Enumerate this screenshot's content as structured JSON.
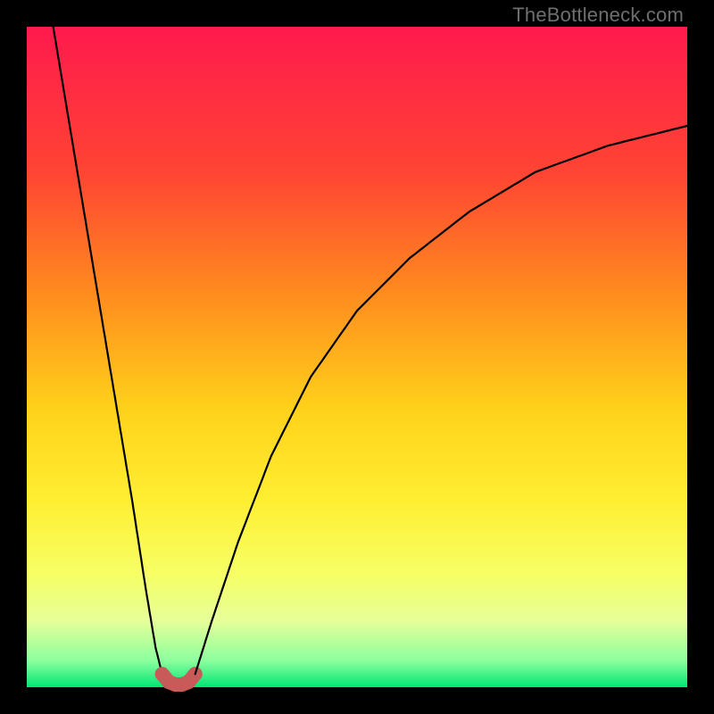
{
  "watermark": "TheBottleneck.com",
  "chart_data": {
    "type": "line",
    "title": "",
    "xlabel": "",
    "ylabel": "",
    "xlim": [
      0,
      100
    ],
    "ylim": [
      0,
      100
    ],
    "annotations": [
      "TheBottleneck.com"
    ],
    "background": {
      "type": "vertical-gradient",
      "stops": [
        {
          "pos": 0.0,
          "color": "#ff1a4d"
        },
        {
          "pos": 0.22,
          "color": "#ff4433"
        },
        {
          "pos": 0.4,
          "color": "#ff8a1f"
        },
        {
          "pos": 0.58,
          "color": "#ffd21a"
        },
        {
          "pos": 0.72,
          "color": "#ffef33"
        },
        {
          "pos": 0.83,
          "color": "#f6ff66"
        },
        {
          "pos": 0.9,
          "color": "#e6ff99"
        },
        {
          "pos": 0.96,
          "color": "#8cff9e"
        },
        {
          "pos": 1.0,
          "color": "#00e676"
        }
      ]
    },
    "series": [
      {
        "name": "left-branch",
        "stroke": "#000000",
        "x": [
          4,
          6,
          8,
          10,
          12,
          14,
          16,
          18,
          19.5,
          20.5
        ],
        "y": [
          100,
          88,
          76,
          64,
          52,
          40,
          28,
          15,
          6,
          2
        ]
      },
      {
        "name": "valley-points",
        "stroke": "#c95a5a",
        "marker": "dot",
        "x": [
          20.5,
          21.5,
          22.5,
          23.5,
          24.5,
          25.5
        ],
        "y": [
          2.0,
          0.8,
          0.4,
          0.4,
          0.8,
          2.0
        ]
      },
      {
        "name": "right-branch",
        "stroke": "#000000",
        "x": [
          25.5,
          28,
          32,
          37,
          43,
          50,
          58,
          67,
          77,
          88,
          100
        ],
        "y": [
          2,
          10,
          22,
          35,
          47,
          57,
          65,
          72,
          78,
          82,
          85
        ]
      }
    ],
    "notch_center_x": 23,
    "notch_min_y": 0.4
  }
}
